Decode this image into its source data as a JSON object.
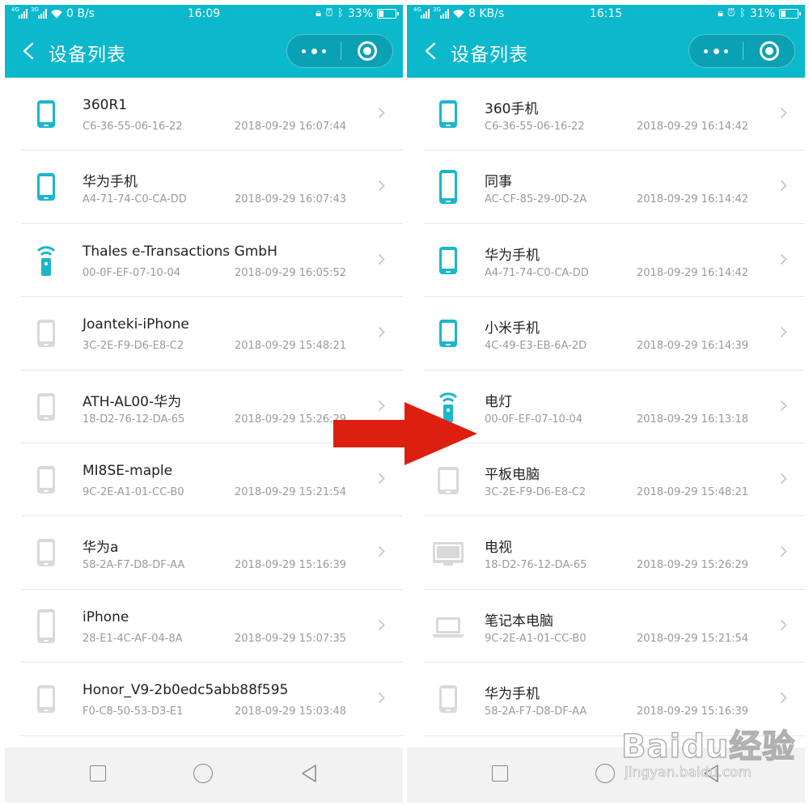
{
  "colors": {
    "accent": "#0bb8cc",
    "device_active": "#1ab6cb",
    "device_inactive": "#d9d9d9",
    "arrow": "#dd1f10"
  },
  "screens": [
    {
      "status": {
        "speed": "0 B/s",
        "time": "16:09",
        "battery": "33%",
        "battery_level": 0.33
      },
      "title": "设备列表",
      "devices": [
        {
          "name": "360R1",
          "mac": "C6-36-55-06-16-22",
          "time": "2018-09-29 16:07:44",
          "icon": "phone-icon",
          "active": true
        },
        {
          "name": "华为手机",
          "mac": "A4-71-74-C0-CA-DD",
          "time": "2018-09-29 16:07:43",
          "icon": "phone-icon",
          "active": true
        },
        {
          "name": "Thales e-Transactions GmbH",
          "mac": "00-0F-EF-07-10-04",
          "time": "2018-09-29 16:05:52",
          "icon": "wifi-remote-icon",
          "active": true
        },
        {
          "name": "Joanteki-iPhone",
          "mac": "3C-2E-F9-D6-E8-C2",
          "time": "2018-09-29 15:48:21",
          "icon": "phone-icon",
          "active": false
        },
        {
          "name": "ATH-AL00-华为",
          "mac": "18-D2-76-12-DA-65",
          "time": "2018-09-29 15:26:29",
          "icon": "phone-icon",
          "active": false
        },
        {
          "name": "MI8SE-maple",
          "mac": "9C-2E-A1-01-CC-B0",
          "time": "2018-09-29 15:21:54",
          "icon": "phone-icon",
          "active": false
        },
        {
          "name": "华为a",
          "mac": "58-2A-F7-D8-DF-AA",
          "time": "2018-09-29 15:16:39",
          "icon": "phone-icon",
          "active": false
        },
        {
          "name": "iPhone",
          "mac": "28-E1-4C-AF-04-8A",
          "time": "2018-09-29 15:07:35",
          "icon": "iphone-icon",
          "active": false
        },
        {
          "name": "Honor_V9-2b0edc5abb88f595",
          "mac": "F0-C8-50-53-D3-E1",
          "time": "2018-09-29 15:03:48",
          "icon": "phone-icon",
          "active": false
        }
      ]
    },
    {
      "status": {
        "speed": "8 KB/s",
        "time": "16:15",
        "battery": "31%",
        "battery_level": 0.31
      },
      "title": "设备列表",
      "devices": [
        {
          "name": "360手机",
          "mac": "C6-36-55-06-16-22",
          "time": "2018-09-29 16:14:42",
          "icon": "phone-icon",
          "active": true
        },
        {
          "name": "同事",
          "mac": "AC-CF-85-29-0D-2A",
          "time": "2018-09-29 16:14:42",
          "icon": "iphone-icon",
          "active": true
        },
        {
          "name": "华为手机",
          "mac": "A4-71-74-C0-CA-DD",
          "time": "2018-09-29 16:14:42",
          "icon": "phone-icon",
          "active": true
        },
        {
          "name": "小米手机",
          "mac": "4C-49-E3-EB-6A-2D",
          "time": "2018-09-29 16:14:39",
          "icon": "phone-icon",
          "active": true
        },
        {
          "name": "电灯",
          "mac": "00-0F-EF-07-10-04",
          "time": "2018-09-29 16:13:18",
          "icon": "wifi-remote-icon",
          "active": true
        },
        {
          "name": "平板电脑",
          "mac": "3C-2E-F9-D6-E8-C2",
          "time": "2018-09-29 15:48:21",
          "icon": "tablet-icon",
          "active": false
        },
        {
          "name": "电视",
          "mac": "18-D2-76-12-DA-65",
          "time": "2018-09-29 15:26:29",
          "icon": "tv-icon",
          "active": false
        },
        {
          "name": "笔记本电脑",
          "mac": "9C-2E-A1-01-CC-B0",
          "time": "2018-09-29 15:21:54",
          "icon": "laptop-icon",
          "active": false
        },
        {
          "name": "华为手机",
          "mac": "58-2A-F7-D8-DF-AA",
          "time": "2018-09-29 15:16:39",
          "icon": "phone-icon",
          "active": false
        }
      ]
    }
  ],
  "watermark": {
    "logo": "Baidu经验",
    "url": "jingyan.baidu.com"
  }
}
